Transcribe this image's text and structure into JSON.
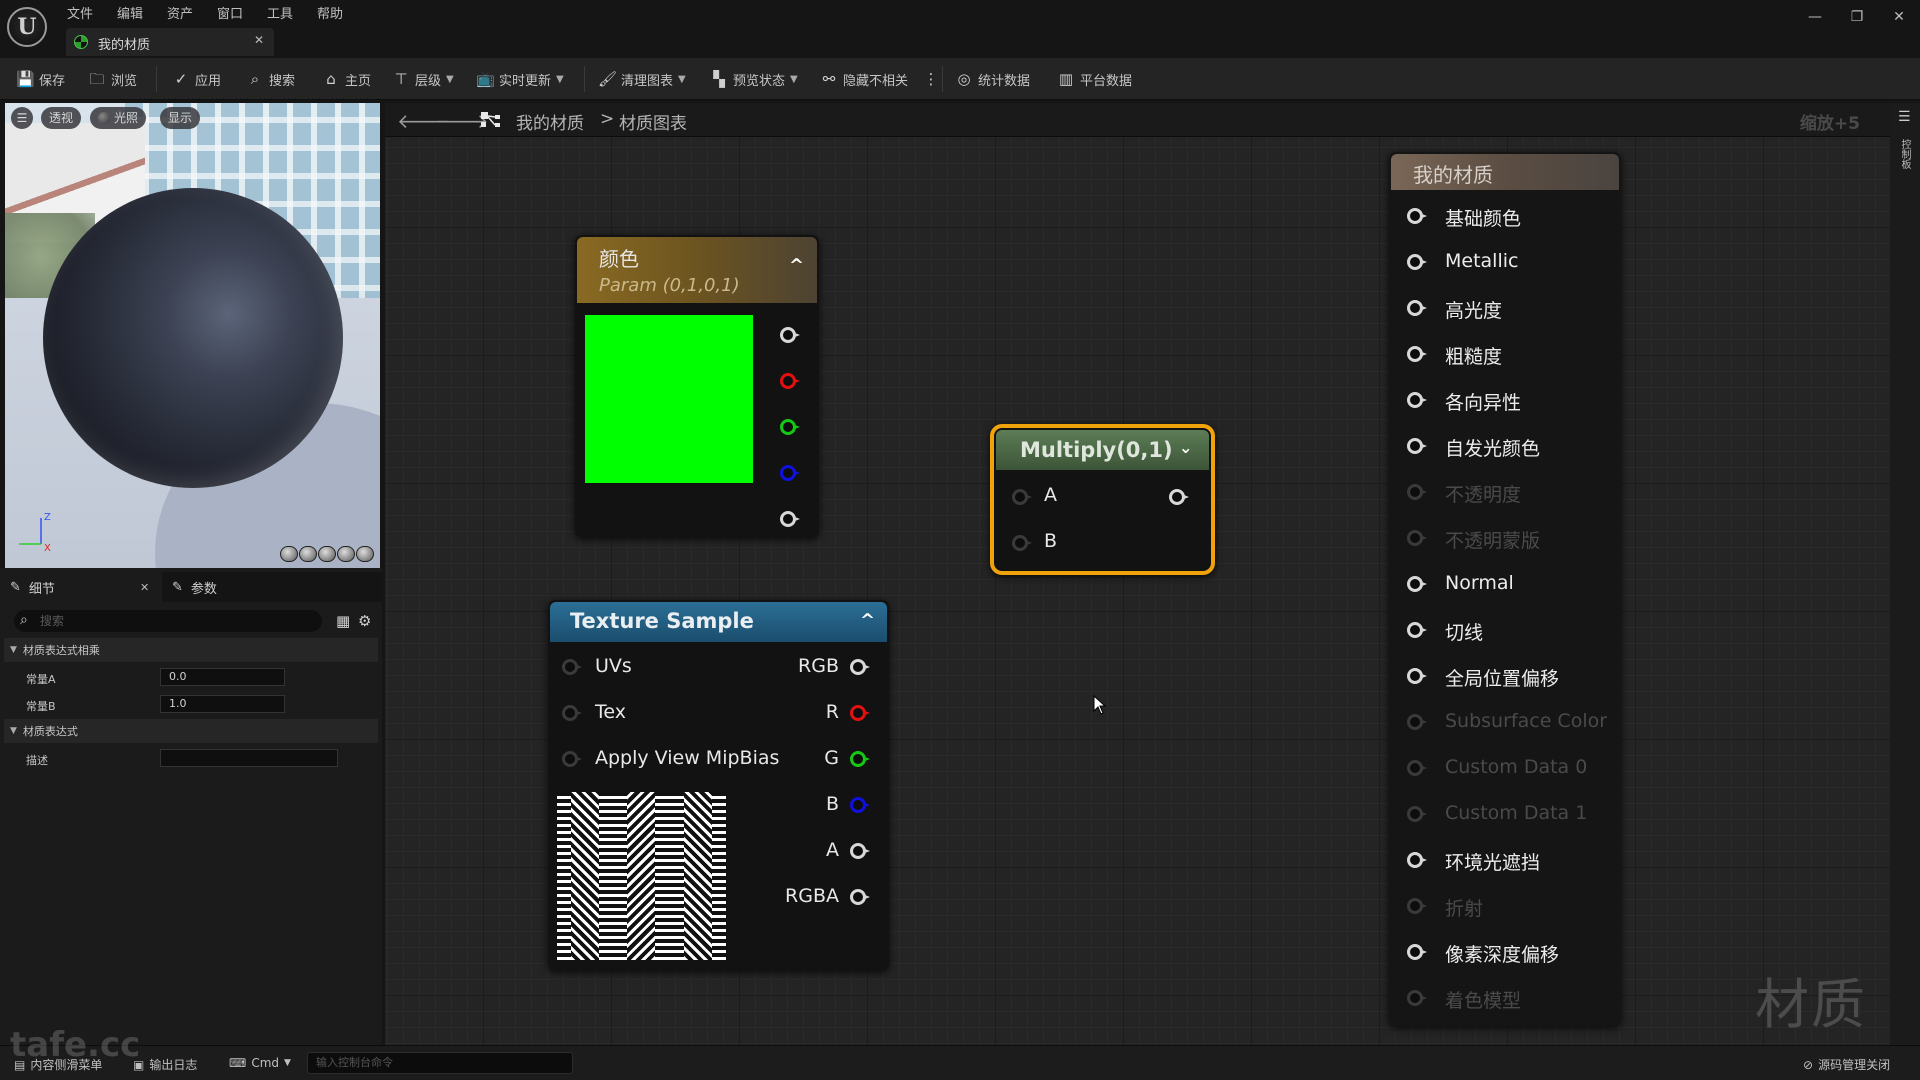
{
  "window": {
    "menu": [
      "文件",
      "编辑",
      "资产",
      "窗口",
      "工具",
      "帮助"
    ],
    "tab_label": "我的材质",
    "controls": {
      "minimize": "—",
      "restore": "❐",
      "close": "✕"
    }
  },
  "toolbar": {
    "items": [
      {
        "label": "保存",
        "icon": "save-icon"
      },
      {
        "label": "浏览",
        "icon": "browse-icon"
      },
      {
        "label": "应用",
        "icon": "apply-icon"
      },
      {
        "label": "搜索",
        "icon": "search-icon"
      },
      {
        "label": "主页",
        "icon": "home-icon"
      },
      {
        "label": "层级",
        "icon": "hierarchy-icon",
        "dropdown": true
      },
      {
        "label": "实时更新",
        "icon": "live-update-icon",
        "dropdown": true
      },
      {
        "label": "清理图表",
        "icon": "clean-graph-icon",
        "dropdown": true
      },
      {
        "label": "预览状态",
        "icon": "preview-state-icon",
        "dropdown": true
      },
      {
        "label": "隐藏不相关",
        "icon": "hide-unrelated-icon"
      },
      {
        "label": "统计数据",
        "icon": "stats-icon"
      },
      {
        "label": "平台数据",
        "icon": "platform-stats-icon"
      }
    ]
  },
  "viewport": {
    "buttons": {
      "menu": "☰",
      "perspective": "透视",
      "lighting": "光照",
      "show": "显示"
    },
    "axes": {
      "z": "Z",
      "x": "X"
    }
  },
  "details": {
    "tabs": {
      "details": "细节",
      "params": "参数"
    },
    "search_placeholder": "搜索",
    "sections": [
      {
        "title": "材质表达式相乘",
        "rows": [
          {
            "label": "常量A",
            "value": "0.0"
          },
          {
            "label": "常量B",
            "value": "1.0"
          }
        ]
      },
      {
        "title": "材质表达式",
        "rows": [
          {
            "label": "描述",
            "value": ""
          }
        ]
      }
    ]
  },
  "graph": {
    "breadcrumb": [
      "我的材质",
      "材质图表"
    ],
    "breadcrumb_sep": ">",
    "zoom_label": "缩放+5",
    "side_panel_label": "控制板",
    "watermark": "材质",
    "nodes": {
      "color": {
        "title": "颜色",
        "subtitle": "Param (0,1,0,1)",
        "swatch": "#00ff00",
        "outputs": [
          "white",
          "red",
          "green",
          "blue",
          "white"
        ]
      },
      "multiply": {
        "title": "Multiply(0,1)",
        "inputs": [
          "A",
          "B"
        ]
      },
      "texture": {
        "title": "Texture Sample",
        "inputs": [
          "UVs",
          "Tex",
          "Apply View MipBias"
        ],
        "outputs": [
          {
            "label": "RGB",
            "color": "white"
          },
          {
            "label": "R",
            "color": "red"
          },
          {
            "label": "G",
            "color": "green"
          },
          {
            "label": "B",
            "color": "blue"
          },
          {
            "label": "A",
            "color": "white"
          },
          {
            "label": "RGBA",
            "color": "white"
          }
        ]
      },
      "result": {
        "title": "我的材质",
        "inputs": [
          {
            "label": "基础颜色",
            "enabled": true
          },
          {
            "label": "Metallic",
            "enabled": true
          },
          {
            "label": "高光度",
            "enabled": true
          },
          {
            "label": "粗糙度",
            "enabled": true
          },
          {
            "label": "各向异性",
            "enabled": true
          },
          {
            "label": "自发光颜色",
            "enabled": true
          },
          {
            "label": "不透明度",
            "enabled": false
          },
          {
            "label": "不透明蒙版",
            "enabled": false
          },
          {
            "label": "Normal",
            "enabled": true
          },
          {
            "label": "切线",
            "enabled": true
          },
          {
            "label": "全局位置偏移",
            "enabled": true
          },
          {
            "label": "Subsurface Color",
            "enabled": false
          },
          {
            "label": "Custom Data 0",
            "enabled": false
          },
          {
            "label": "Custom Data 1",
            "enabled": false
          },
          {
            "label": "环境光遮挡",
            "enabled": true
          },
          {
            "label": "折射",
            "enabled": false
          },
          {
            "label": "像素深度偏移",
            "enabled": true
          },
          {
            "label": "着色模型",
            "enabled": false
          }
        ]
      }
    }
  },
  "statusbar": {
    "content_drawer": "内容侧滑菜单",
    "output_log": "输出日志",
    "cmd": "Cmd",
    "console_placeholder": "输入控制台命令",
    "source_control": "源码管理关闭",
    "overlay_watermark": "tafe.cc"
  },
  "colors": {
    "accent_selected": "#f0a20a",
    "pin_red": "#e21010",
    "pin_green": "#14c814",
    "pin_blue": "#1010e0"
  }
}
